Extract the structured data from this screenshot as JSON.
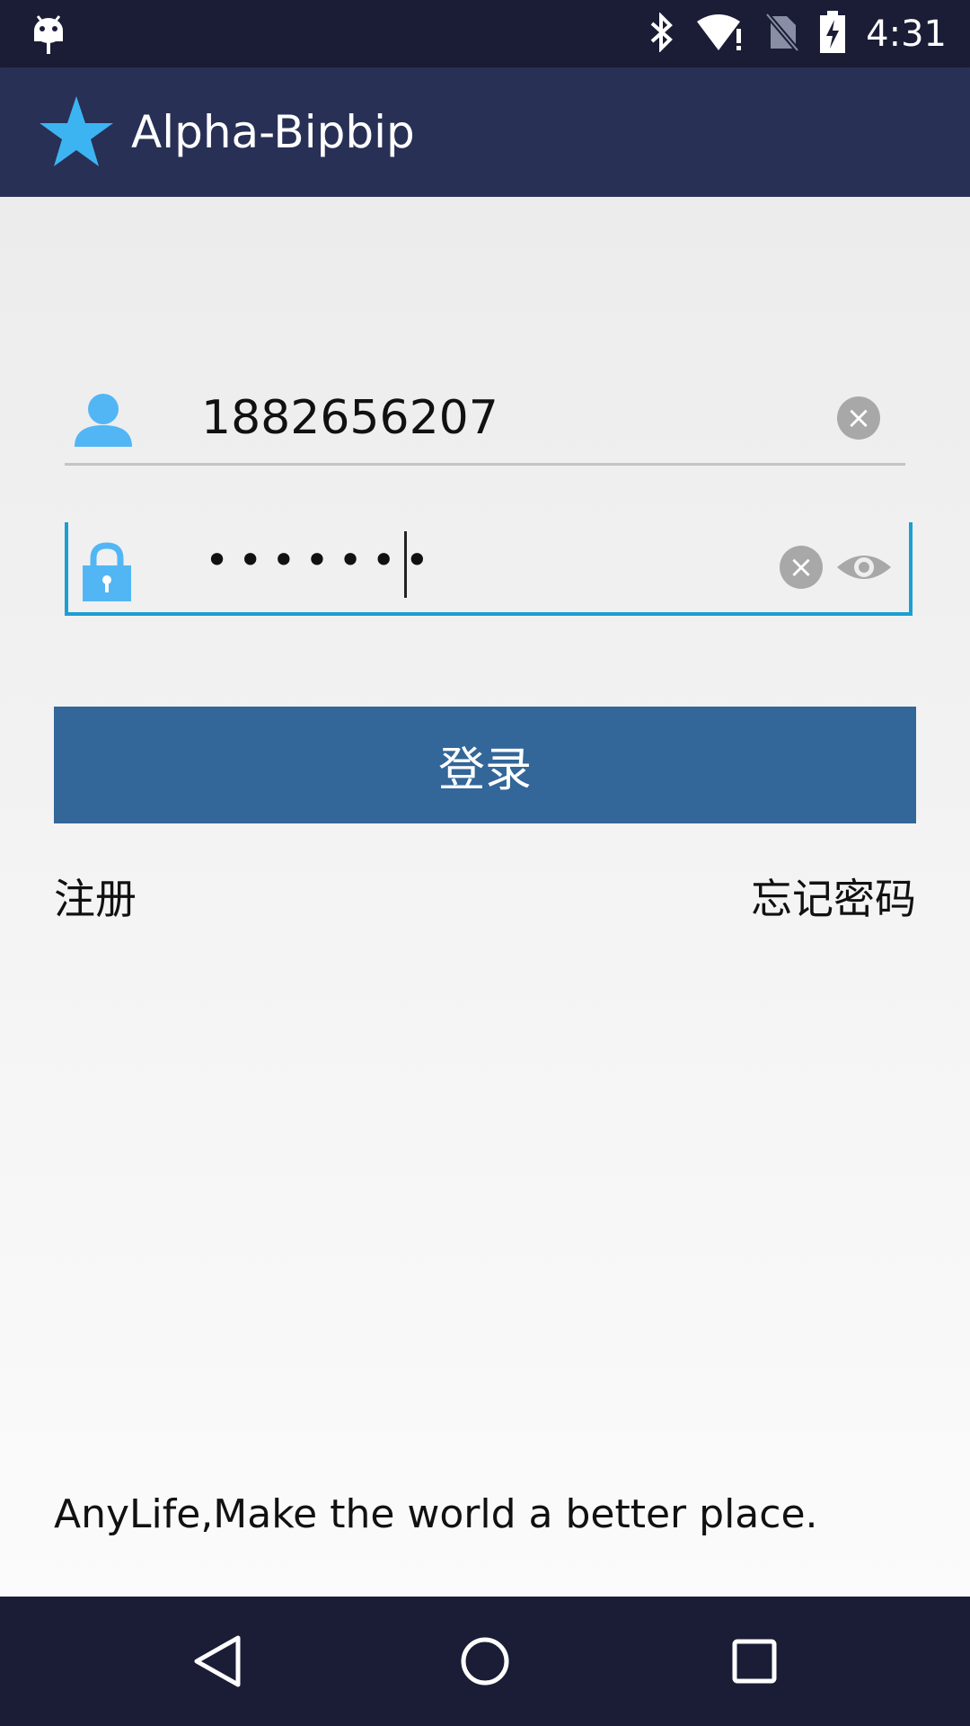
{
  "status_bar": {
    "time": "4:31",
    "icons": [
      "android-debug-icon",
      "bluetooth-icon",
      "wifi-alert-icon",
      "no-sim-icon",
      "battery-charging-icon"
    ]
  },
  "app_bar": {
    "title": "Alpha-Bipbip",
    "logo_icon": "star-icon",
    "logo_color": "#3db4f2"
  },
  "login_form": {
    "username_value": "1882656207",
    "password_value": "•••••••",
    "login_label": "登录",
    "register_label": "注册",
    "forgot_label": "忘记密码",
    "field_icon_color": "#52b6f5",
    "accent_color": "#1b9fd2",
    "button_color": "#336699"
  },
  "footer": {
    "tagline": "AnyLife,Make the world a better place."
  },
  "nav_bar": {
    "buttons": [
      "back-icon",
      "home-icon",
      "recents-icon"
    ]
  }
}
